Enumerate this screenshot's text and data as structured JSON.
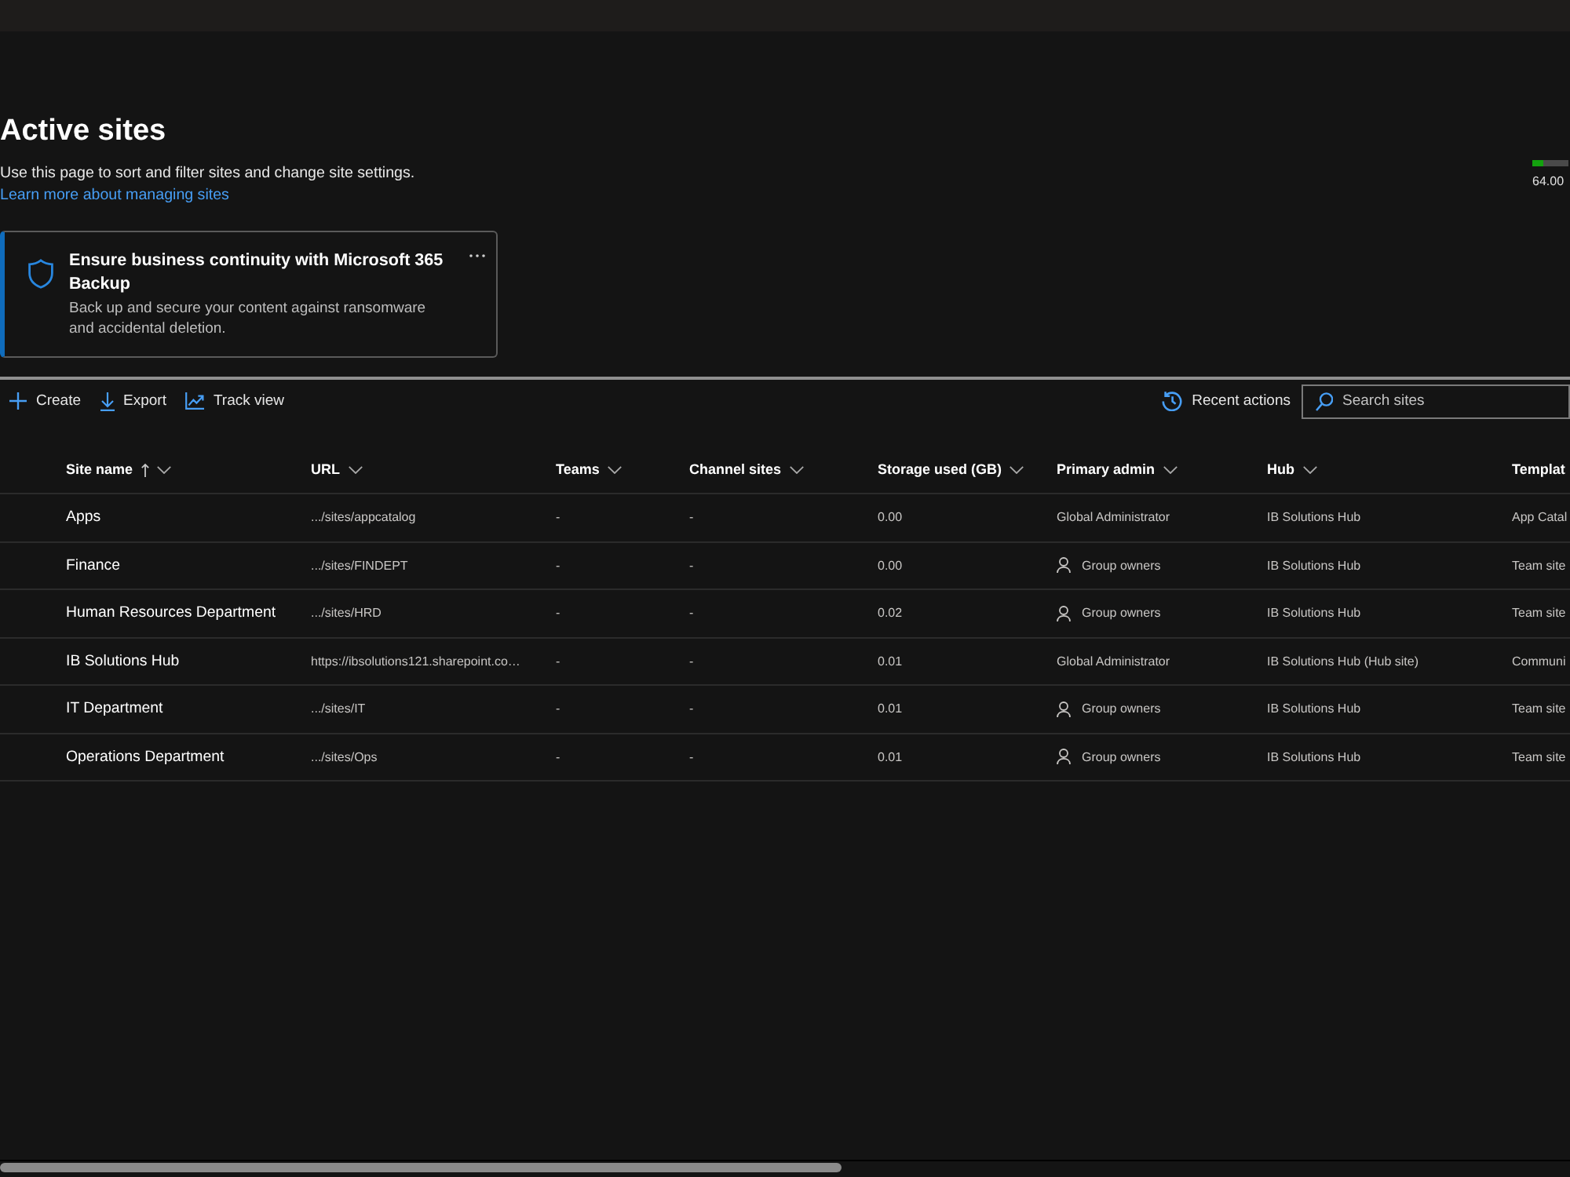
{
  "page": {
    "title": "Active sites",
    "description": "Use this page to sort and filter sites and change site settings.",
    "link": "Learn more about managing sites"
  },
  "storage": {
    "level": 0.3,
    "reading": "64.00"
  },
  "banner": {
    "title": "Ensure business continuity with Microsoft 365 Backup",
    "text": "Back up and secure your content against ransomware and accidental deletion."
  },
  "toolbar": {
    "actions": [
      {
        "label": "Create",
        "kind": "create"
      },
      {
        "label": "Export",
        "kind": "export"
      },
      {
        "label": "Track view",
        "kind": "track"
      }
    ],
    "recent_actions": "Recent actions",
    "search": {
      "placeholder": "Search sites"
    }
  },
  "table": {
    "columns": [
      {
        "label": "Site name",
        "sorted": true,
        "dropdown": true
      },
      {
        "label": "URL",
        "sorted": false,
        "dropdown": true
      },
      {
        "label": "Teams",
        "sorted": false,
        "dropdown": true
      },
      {
        "label": "Channel sites",
        "sorted": false,
        "dropdown": true
      },
      {
        "label": "Storage used (GB)",
        "sorted": false,
        "dropdown": true
      },
      {
        "label": "Primary admin",
        "sorted": false,
        "dropdown": true
      },
      {
        "label": "Hub",
        "sorted": false,
        "dropdown": true
      },
      {
        "label": "Templat",
        "sorted": false,
        "dropdown": false
      }
    ],
    "rows": [
      {
        "site_name": "Apps",
        "url": ".../sites/appcatalog",
        "teams": "-",
        "channel_sites": "-",
        "storage_used": "0.00",
        "primary_admin": {
          "text": "Global Administrator",
          "kind": "user"
        },
        "hub": "IB Solutions Hub",
        "column_8": "App Catal"
      },
      {
        "site_name": "Finance",
        "url": ".../sites/FINDEPT",
        "teams": "-",
        "channel_sites": "-",
        "storage_used": "0.00",
        "primary_admin": {
          "text": "Group owners",
          "kind": "group"
        },
        "hub": "IB Solutions Hub",
        "column_8": "Team site"
      },
      {
        "site_name": "Human Resources Department",
        "url": ".../sites/HRD",
        "teams": "-",
        "channel_sites": "-",
        "storage_used": "0.02",
        "primary_admin": {
          "text": "Group owners",
          "kind": "group"
        },
        "hub": "IB Solutions Hub",
        "column_8": "Team site"
      },
      {
        "site_name": "IB Solutions Hub",
        "url": "https://ibsolutions121.sharepoint.co…",
        "teams": "-",
        "channel_sites": "-",
        "storage_used": "0.01",
        "primary_admin": {
          "text": "Global Administrator",
          "kind": "user"
        },
        "hub": "IB Solutions Hub (Hub site)",
        "column_8": "Communi"
      },
      {
        "site_name": "IT Department",
        "url": ".../sites/IT",
        "teams": "-",
        "channel_sites": "-",
        "storage_used": "0.01",
        "primary_admin": {
          "text": "Group owners",
          "kind": "group"
        },
        "hub": "IB Solutions Hub",
        "column_8": "Team site"
      },
      {
        "site_name": "Operations Department",
        "url": ".../sites/Ops",
        "teams": "-",
        "channel_sites": "-",
        "storage_used": "0.01",
        "primary_admin": {
          "text": "Group owners",
          "kind": "group"
        },
        "hub": "IB Solutions Hub",
        "column_8": "Team site"
      }
    ]
  }
}
